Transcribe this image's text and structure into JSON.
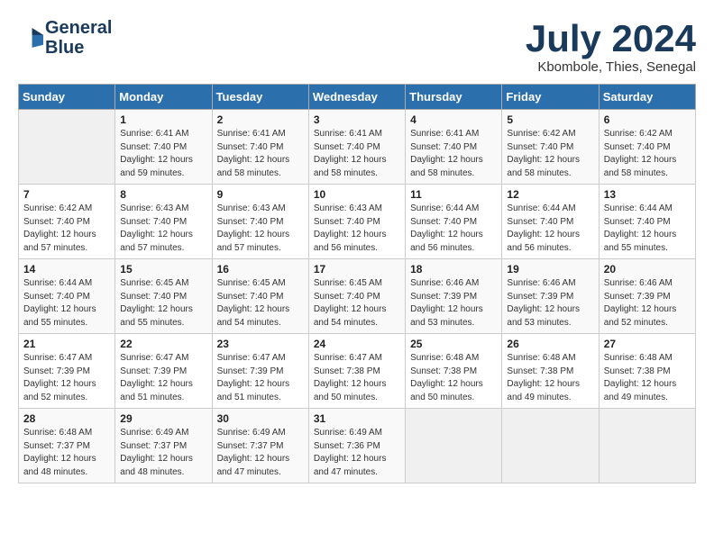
{
  "header": {
    "logo_line1": "General",
    "logo_line2": "Blue",
    "month_title": "July 2024",
    "subtitle": "Kbombole, Thies, Senegal"
  },
  "weekdays": [
    "Sunday",
    "Monday",
    "Tuesday",
    "Wednesday",
    "Thursday",
    "Friday",
    "Saturday"
  ],
  "weeks": [
    [
      {
        "day": "",
        "sunrise": "",
        "sunset": "",
        "daylight": ""
      },
      {
        "day": "1",
        "sunrise": "6:41 AM",
        "sunset": "7:40 PM",
        "daylight": "12 hours and 59 minutes."
      },
      {
        "day": "2",
        "sunrise": "6:41 AM",
        "sunset": "7:40 PM",
        "daylight": "12 hours and 58 minutes."
      },
      {
        "day": "3",
        "sunrise": "6:41 AM",
        "sunset": "7:40 PM",
        "daylight": "12 hours and 58 minutes."
      },
      {
        "day": "4",
        "sunrise": "6:41 AM",
        "sunset": "7:40 PM",
        "daylight": "12 hours and 58 minutes."
      },
      {
        "day": "5",
        "sunrise": "6:42 AM",
        "sunset": "7:40 PM",
        "daylight": "12 hours and 58 minutes."
      },
      {
        "day": "6",
        "sunrise": "6:42 AM",
        "sunset": "7:40 PM",
        "daylight": "12 hours and 58 minutes."
      }
    ],
    [
      {
        "day": "7",
        "sunrise": "6:42 AM",
        "sunset": "7:40 PM",
        "daylight": "12 hours and 57 minutes."
      },
      {
        "day": "8",
        "sunrise": "6:43 AM",
        "sunset": "7:40 PM",
        "daylight": "12 hours and 57 minutes."
      },
      {
        "day": "9",
        "sunrise": "6:43 AM",
        "sunset": "7:40 PM",
        "daylight": "12 hours and 57 minutes."
      },
      {
        "day": "10",
        "sunrise": "6:43 AM",
        "sunset": "7:40 PM",
        "daylight": "12 hours and 56 minutes."
      },
      {
        "day": "11",
        "sunrise": "6:44 AM",
        "sunset": "7:40 PM",
        "daylight": "12 hours and 56 minutes."
      },
      {
        "day": "12",
        "sunrise": "6:44 AM",
        "sunset": "7:40 PM",
        "daylight": "12 hours and 56 minutes."
      },
      {
        "day": "13",
        "sunrise": "6:44 AM",
        "sunset": "7:40 PM",
        "daylight": "12 hours and 55 minutes."
      }
    ],
    [
      {
        "day": "14",
        "sunrise": "6:44 AM",
        "sunset": "7:40 PM",
        "daylight": "12 hours and 55 minutes."
      },
      {
        "day": "15",
        "sunrise": "6:45 AM",
        "sunset": "7:40 PM",
        "daylight": "12 hours and 55 minutes."
      },
      {
        "day": "16",
        "sunrise": "6:45 AM",
        "sunset": "7:40 PM",
        "daylight": "12 hours and 54 minutes."
      },
      {
        "day": "17",
        "sunrise": "6:45 AM",
        "sunset": "7:40 PM",
        "daylight": "12 hours and 54 minutes."
      },
      {
        "day": "18",
        "sunrise": "6:46 AM",
        "sunset": "7:39 PM",
        "daylight": "12 hours and 53 minutes."
      },
      {
        "day": "19",
        "sunrise": "6:46 AM",
        "sunset": "7:39 PM",
        "daylight": "12 hours and 53 minutes."
      },
      {
        "day": "20",
        "sunrise": "6:46 AM",
        "sunset": "7:39 PM",
        "daylight": "12 hours and 52 minutes."
      }
    ],
    [
      {
        "day": "21",
        "sunrise": "6:47 AM",
        "sunset": "7:39 PM",
        "daylight": "12 hours and 52 minutes."
      },
      {
        "day": "22",
        "sunrise": "6:47 AM",
        "sunset": "7:39 PM",
        "daylight": "12 hours and 51 minutes."
      },
      {
        "day": "23",
        "sunrise": "6:47 AM",
        "sunset": "7:39 PM",
        "daylight": "12 hours and 51 minutes."
      },
      {
        "day": "24",
        "sunrise": "6:47 AM",
        "sunset": "7:38 PM",
        "daylight": "12 hours and 50 minutes."
      },
      {
        "day": "25",
        "sunrise": "6:48 AM",
        "sunset": "7:38 PM",
        "daylight": "12 hours and 50 minutes."
      },
      {
        "day": "26",
        "sunrise": "6:48 AM",
        "sunset": "7:38 PM",
        "daylight": "12 hours and 49 minutes."
      },
      {
        "day": "27",
        "sunrise": "6:48 AM",
        "sunset": "7:38 PM",
        "daylight": "12 hours and 49 minutes."
      }
    ],
    [
      {
        "day": "28",
        "sunrise": "6:48 AM",
        "sunset": "7:37 PM",
        "daylight": "12 hours and 48 minutes."
      },
      {
        "day": "29",
        "sunrise": "6:49 AM",
        "sunset": "7:37 PM",
        "daylight": "12 hours and 48 minutes."
      },
      {
        "day": "30",
        "sunrise": "6:49 AM",
        "sunset": "7:37 PM",
        "daylight": "12 hours and 47 minutes."
      },
      {
        "day": "31",
        "sunrise": "6:49 AM",
        "sunset": "7:36 PM",
        "daylight": "12 hours and 47 minutes."
      },
      {
        "day": "",
        "sunrise": "",
        "sunset": "",
        "daylight": ""
      },
      {
        "day": "",
        "sunrise": "",
        "sunset": "",
        "daylight": ""
      },
      {
        "day": "",
        "sunrise": "",
        "sunset": "",
        "daylight": ""
      }
    ]
  ]
}
